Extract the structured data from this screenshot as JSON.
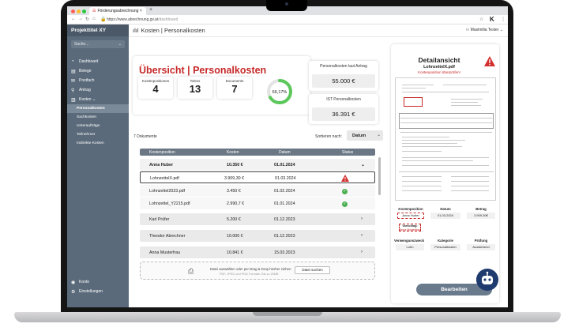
{
  "browser": {
    "tab_title": "Förderungsabrechnung",
    "url_host": "https://www.abrechnung.gv.at",
    "url_path": "/dashboard",
    "add_tab": "+",
    "logo": "K"
  },
  "sidebar": {
    "project": "Projekttitel XY",
    "search_placeholder": "Suche...",
    "items": [
      {
        "label": "Dashboard",
        "icon": "dashboard-icon"
      },
      {
        "label": "Belege",
        "icon": "document-icon"
      },
      {
        "label": "Postfach",
        "icon": "mail-icon"
      },
      {
        "label": "Antrag",
        "icon": "pin-icon"
      },
      {
        "label": "Kosten",
        "icon": "bar-chart-icon"
      }
    ],
    "sub_items": [
      "Personalkosten",
      "Sachkosten",
      "Unteraufträge",
      "Teilnehmer",
      "Indirekte Kosten"
    ],
    "bottom": [
      {
        "label": "Konto",
        "icon": "account-icon"
      },
      {
        "label": "Einstellungen",
        "icon": "gear-icon"
      }
    ]
  },
  "topbar": {
    "title": "Kosten | Personalkosten",
    "user": "Maximilia Tester"
  },
  "summary": {
    "title": "Übersicht | Personalkosten",
    "stats": [
      {
        "label": "Kostenpositionen",
        "value": "4"
      },
      {
        "label": "ToDos",
        "value": "13"
      },
      {
        "label": "Documents",
        "value": "7"
      }
    ],
    "gauge_label": "66,17%",
    "gauge_fraction": 0.6617,
    "kpi_antrag_label": "Personalkosten laut Antrag",
    "kpi_antrag_value": "55.000 €",
    "kpi_ist_label": "IST Personalkosten",
    "kpi_ist_value": "36.391 €"
  },
  "list": {
    "count_text": "7 Dokumente",
    "sort_label": "Sortieren nach:",
    "sort_value": "Datum",
    "headers": {
      "position": "Kostenposition",
      "kosten": "Kosten",
      "datum": "Datum",
      "status": "Status"
    },
    "rows": [
      {
        "position": "Anna Huber",
        "kosten": "10.350 €",
        "datum": "01.01.2024",
        "status": "expanded"
      },
      {
        "position": "LohnzettelX.pdf",
        "kosten": "3.909,30 €",
        "datum": "01.03.2024",
        "status": "warning"
      },
      {
        "position": "Lohnzettel2023.pdf",
        "kosten": "3.450 €",
        "datum": "01.02.2024",
        "status": "ok"
      },
      {
        "position": "Lohnzettel_Y2215.pdf",
        "kosten": "2.990,7 €",
        "datum": "01.01.2024",
        "status": "ok"
      },
      {
        "position": "Karl Prüfer",
        "kosten": "5.200 €",
        "datum": "01.12.2023",
        "status": "collapsed"
      },
      {
        "position": "Theodor Abrechner",
        "kosten": "10.000 €",
        "datum": "01.12.2023",
        "status": "collapsed"
      },
      {
        "position": "Anna Musterfrau",
        "kosten": "10.841 €",
        "datum": "15.03.2023",
        "status": "collapsed"
      }
    ],
    "dropzone_text": "Datei auswählen oder per Drag & Drop hierher ziehen",
    "dropzone_sub": "PDF, JPEG und PNG Formate, Bis zu 20MB",
    "dropzone_button": "Datei suchen"
  },
  "detail": {
    "title": "Detailansicht",
    "file": "LohnzettelX.pdf",
    "note": "Kostenposition überprüfen!",
    "kostenposition_label": "Kostenposition",
    "kostenposition_value": "Anna Huber",
    "suggestion_label": "Vorschlag:",
    "suggestion_value": "Anna Musterfrau",
    "datum_label": "Datum",
    "datum_value": "01.03.2024",
    "betrag_label": "Betrag",
    "betrag_value": "3.909,30€",
    "zweck_label": "Verwengunszweck",
    "zweck_value": "Lohn",
    "kategorie_label": "Kategorie",
    "kategorie_value": "Personalkosten",
    "pruefung_label": "Prüfung",
    "pruefung_value": "Ausstehend",
    "edit_button": "Bearbeiten"
  },
  "colors": {
    "accent_red": "#c62828",
    "sidebar": "#5a6a7a",
    "ok_green": "#4caf50",
    "gauge_green": "#5cc85c",
    "bot": "#1e3a6e"
  }
}
